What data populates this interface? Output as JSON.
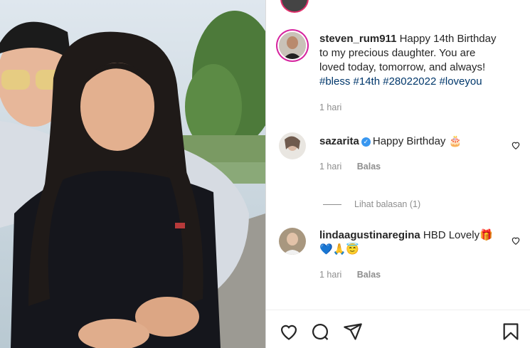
{
  "caption": {
    "username": "steven_rum911",
    "text": "Happy 14th Birthday to my precious daughter. You are loved today, tomorrow, and always!",
    "hashtags": [
      "#bless",
      "#14th",
      "#28022022",
      "#loveyou"
    ],
    "time": "1 hari"
  },
  "comments": [
    {
      "username": "sazarita",
      "verified": true,
      "text": "Happy Birthday",
      "emoji": "🎂",
      "time": "1 hari",
      "reply_label": "Balas"
    },
    {
      "username": "lindaagustinaregina",
      "verified": false,
      "text": "HBD Lovely",
      "emoji": "🎁",
      "emoji_line": "💙🙏😇",
      "time": "1 hari",
      "reply_label": "Balas"
    }
  ],
  "view_replies_label": "Lihat balasan (1)",
  "icons": [
    "heart-icon",
    "comment-icon",
    "share-icon",
    "bookmark-icon"
  ]
}
